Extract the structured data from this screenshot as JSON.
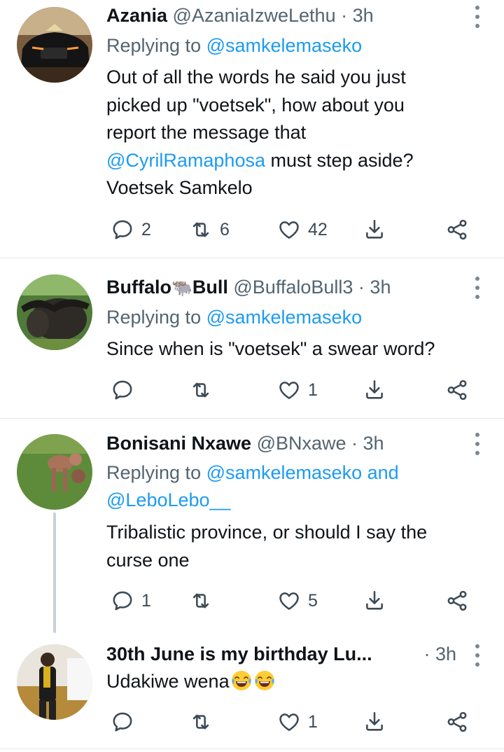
{
  "tweets": [
    {
      "name": "Azania",
      "handle": "@AzaniaIzweLethu",
      "sep": " · ",
      "time": "3h",
      "reply_prefix": "Replying to ",
      "reply_to": "@samkelemaseko",
      "body": {
        "line1": "Out of all the words he said you just",
        "line2": "picked up \"voetsek\", how about you",
        "line3": "report the message that",
        "mention": "@CyrilRamaphosa",
        "line4_rest": " must step aside?",
        "line5": "Voetsek Samkelo"
      },
      "actions": {
        "replies": "2",
        "retweets": "6",
        "likes": "42"
      }
    },
    {
      "name_part1": "Buffalo",
      "name_emoji": "🐃",
      "name_part2": "Bull",
      "handle": "@BuffaloBull3",
      "sep": " · ",
      "time": "3h",
      "reply_prefix": "Replying to ",
      "reply_to": "@samkelemaseko",
      "body": "Since when is \"voetsek\" a swear word?",
      "actions": {
        "replies": "",
        "retweets": "",
        "likes": "1"
      }
    },
    {
      "name": "Bonisani Nxawe",
      "handle": "@BNxawe",
      "sep": " · ",
      "time": "3h",
      "reply_prefix": "Replying to ",
      "reply_to": "@samkelemaseko and",
      "reply_to_2": "@LeboLebo__",
      "body": {
        "line1": "Tribalistic province, or should I say the",
        "line2": "curse one"
      },
      "actions": {
        "replies": "1",
        "retweets": "",
        "likes": "5"
      }
    },
    {
      "name": "30th June is my birthday Lu...",
      "sep": " · ",
      "time": "3h",
      "body": "Udakiwe wena",
      "body_emoji": "😂😂",
      "actions": {
        "replies": "",
        "retweets": "",
        "likes": "1"
      }
    }
  ],
  "icons": {
    "reply": "reply-icon",
    "retweet": "retweet-icon",
    "like": "heart-icon",
    "download": "download-icon",
    "share": "share-icon",
    "more": "more-vertical-icon"
  },
  "colors": {
    "link": "#1d9bf0",
    "secondary": "#536471",
    "text": "#0f1419",
    "divider": "#e3e7ea"
  }
}
